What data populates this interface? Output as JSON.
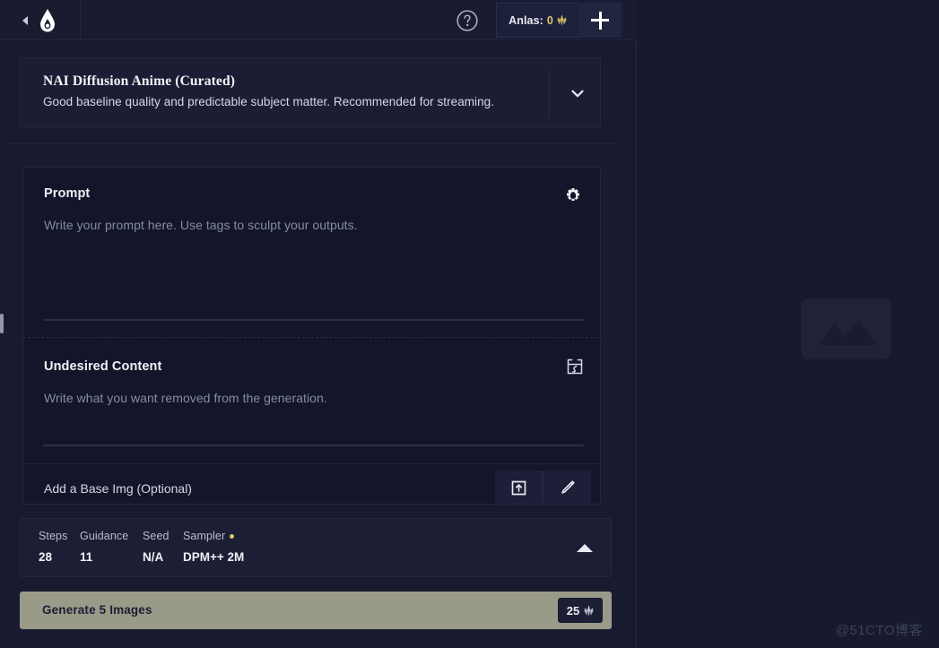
{
  "app": {
    "background_color": "#171a2e",
    "panel_color": "#181b30",
    "accent_color": "#d8c86a",
    "generate_button_color": "#9a9a89"
  },
  "topbar": {
    "collapse_icon": "chevron-left-icon",
    "logo_icon": "novelai-pen-nib-logo",
    "help_icon": "question-mark-circle-icon",
    "anlas": {
      "label": "Anlas:",
      "value": "0",
      "currency_icon": "anlas-icon"
    },
    "add_button_label": "+",
    "add_icon": "plus-icon"
  },
  "model_card": {
    "title": "NAI Diffusion Anime (Curated)",
    "description": "Good baseline quality and predictable subject matter. Recommended for streaming.",
    "expand_icon": "chevron-down-icon"
  },
  "prompt": {
    "title": "Prompt",
    "placeholder": "Write your prompt here. Use tags to sculpt your outputs.",
    "value": "",
    "settings_icon": "gear-icon"
  },
  "undesired_content": {
    "title": "Undesired Content",
    "placeholder": "Write what you want removed from the generation.",
    "value": "",
    "insert_icon": "insert-preset-icon"
  },
  "base_image": {
    "label": "Add a Base Img (Optional)",
    "upload_icon": "upload-image-icon",
    "paint_icon": "paintbrush-icon"
  },
  "settings": {
    "items": [
      {
        "label": "Steps",
        "value": "28"
      },
      {
        "label": "Guidance",
        "value": "11"
      },
      {
        "label": "Seed",
        "value": "N/A"
      },
      {
        "label": "Sampler",
        "value": "DPM++ 2M"
      }
    ],
    "sampler_dot_color": "#d8c86a",
    "collapse_icon": "chevron-up-icon"
  },
  "generate": {
    "label": "Generate 5 Images",
    "cost": "25",
    "cost_icon": "anlas-icon"
  },
  "preview": {
    "placeholder_icon": "image-placeholder-icon"
  },
  "watermark": {
    "text": "@51CTO博客"
  }
}
